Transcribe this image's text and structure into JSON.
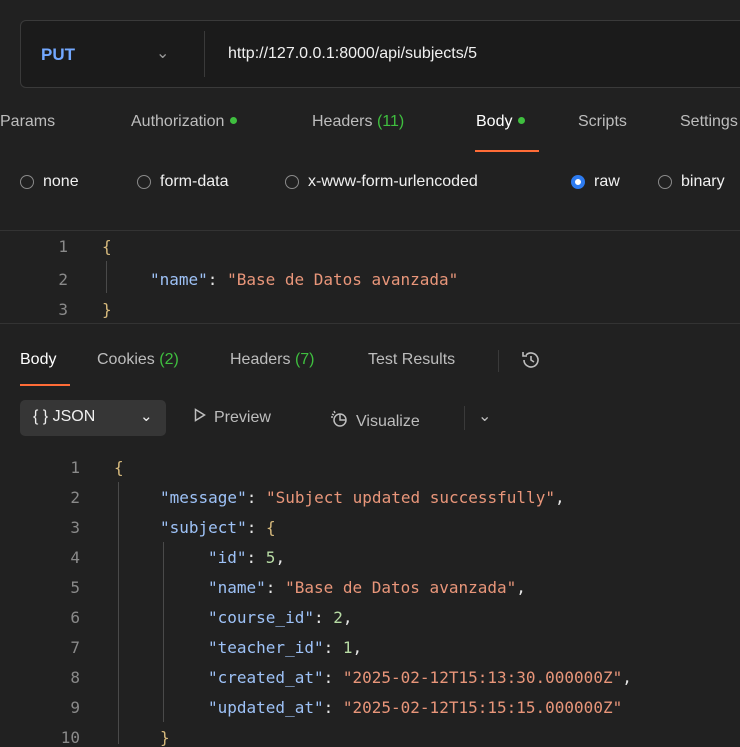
{
  "request": {
    "method": "PUT",
    "url": "http://127.0.0.1:8000/api/subjects/5"
  },
  "request_tabs": {
    "params": "Params",
    "authorization": "Authorization",
    "headers": "Headers",
    "headers_count": "(11)",
    "body": "Body",
    "scripts": "Scripts",
    "settings": "Settings"
  },
  "body_types": {
    "none": "none",
    "form_data": "form-data",
    "urlencoded": "x-www-form-urlencoded",
    "raw": "raw",
    "binary": "binary",
    "selected": "raw"
  },
  "request_body": {
    "line_numbers": [
      "1",
      "2",
      "3"
    ],
    "open": "{",
    "key": "\"name\"",
    "colon": ": ",
    "value": "\"Base de Datos avanzada\"",
    "close": "}"
  },
  "response_tabs": {
    "body": "Body",
    "cookies": "Cookies",
    "cookies_count": "(2)",
    "headers": "Headers",
    "headers_count": "(7)",
    "test_results": "Test Results"
  },
  "response_toolbar": {
    "format": "{ }  JSON",
    "preview": "Preview",
    "visualize": "Visualize"
  },
  "response_body": {
    "line_numbers": [
      "1",
      "2",
      "3",
      "4",
      "5",
      "6",
      "7",
      "8",
      "9",
      "10"
    ],
    "open": "{",
    "message_key": "\"message\"",
    "message_value": "\"Subject updated successfully\"",
    "subject_key": "\"subject\"",
    "id_key": "\"id\"",
    "id_value": "5",
    "name_key": "\"name\"",
    "name_value": "\"Base de Datos avanzada\"",
    "course_id_key": "\"course_id\"",
    "course_id_value": "2",
    "teacher_id_key": "\"teacher_id\"",
    "teacher_id_value": "1",
    "created_at_key": "\"created_at\"",
    "created_at_value": "\"2025-02-12T15:13:30.000000Z\"",
    "updated_at_key": "\"updated_at\"",
    "updated_at_value": "\"2025-02-12T15:15:15.000000Z\"",
    "close_inner": "}"
  },
  "colors": {
    "accent": "#ff6c37",
    "method": "#73a8ff",
    "status_green": "#3fbf3f",
    "json_key": "#9ec2f7",
    "json_string": "#e9967a",
    "json_number": "#b7dba4"
  },
  "icons": [
    "chevron-down-icon",
    "radio-icon",
    "history-icon",
    "play-icon",
    "visualize-icon"
  ]
}
